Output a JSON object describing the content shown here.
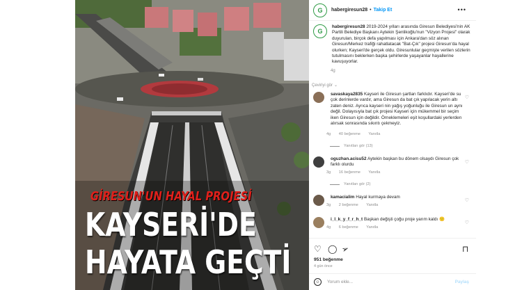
{
  "post": {
    "username": "habergiresun28",
    "follow_label": "Takip Et",
    "more_icon": "•••",
    "avatar_letter": "G"
  },
  "image_overlay": {
    "subtitle": "GİRESUN'UN HAYAL PROJESİ",
    "line1": "KAYSERİ'DE",
    "line2": "HAYATA GEÇTİ"
  },
  "caption": {
    "username": "habergiresun28",
    "text": "2019-2024 yılları arasında Giresun Belediyesi'nin AK Partili Belediye Başkanı Aytekin Şenlikoğlu'nun \"Vizyon Projesi\" olarak duyurulan, birçok defa yapılması için Ankara'dan söz alınan Giresun/Merkez trafiği rahatlatacak \"Bat-Çık\" projesi Giresun'da hayal olurken; Kayseri'de gerçek oldu. Giresunlular geçmişte verilen sözlerin tutulmasını beklerken başka şehirlerde yaşayanlar hayallerine kavuşuyorlar.",
    "time": "4g",
    "translate": "Çeviriyi gör"
  },
  "comments": [
    {
      "username": "savaskaya2835",
      "text": "Kayseri ile Giresun şartları farklıdır. Kayseri'de su çok derinlerde vardır, ama Giresun da bat çık yapılacak yerin altı zaten deniz. Ayrıca kayseri nin yağış yoğunluğu ile Giresun un aynı değil. Dolayısıyla bat çık projesi Kayseri için mükemmel bir seçim iken Giresun için değildir. Örneklemeleri eşit koşullardaki yerlerden alırsak sonrasında sıkıntı çekmeyiz.",
      "time": "4g",
      "likes": "40 beğenme",
      "reply": "Yanıtla",
      "view_replies": "Yanıtları gör (13)"
    },
    {
      "username": "oguzhan.acisu52",
      "text": "Aytekin başkan bu dönem olsaydı Giresun çok farklı olurdu",
      "time": "3g",
      "likes": "16 beğenme",
      "reply": "Yanıtla",
      "view_replies": "Yanıtları gör (2)"
    },
    {
      "username": "kamacialim",
      "text": "Hayal kurmaya devam",
      "time": "3g",
      "likes": "2 beğenme",
      "reply": "Yanıtla"
    },
    {
      "username": "i_l_k_y_f_r_h_t",
      "text": "Başkan değişti çoğu proje yarım kaldı 🙁",
      "time": "4g",
      "likes": "6 beğenme",
      "reply": "Yanıtla"
    }
  ],
  "actions": {
    "like_icon": "heart-icon",
    "comment_icon": "comment-icon",
    "share_icon": "send-icon",
    "save_icon": "bookmark-icon",
    "likes_count": "951 beğenme",
    "posted_ago": "4 gün önce"
  },
  "add_comment": {
    "placeholder": "Yorum ekle...",
    "submit": "Paylaş"
  },
  "colors": {
    "brand_green": "#2e9b45",
    "link_blue": "#0095f6",
    "overlay_red": "#e0201b"
  }
}
